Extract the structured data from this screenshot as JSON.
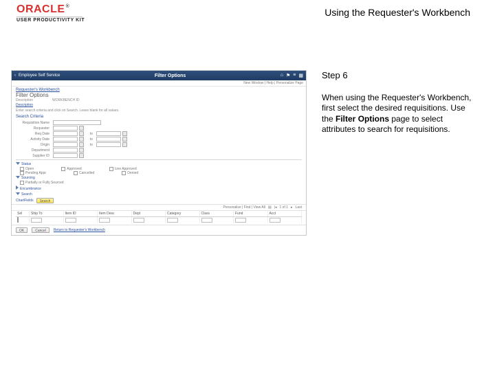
{
  "header": {
    "brand_top": "ORACLE",
    "brand_bottom": "USER PRODUCTIVITY KIT",
    "doc_title": "Using the Requester's Workbench"
  },
  "instruction": {
    "step_label": "Step 6",
    "text_before_bold": "When using the Requester's Workbench, first select the desired requisitions. Use the ",
    "bold": "Filter Options",
    "text_after_bold": " page to select attributes to search for requisitions."
  },
  "screenshot": {
    "topbar": {
      "back_label": "Employee Self Service",
      "title": "Filter Options"
    },
    "breadcrumb": "Requester's Workbench",
    "page_heading": "Filter Options",
    "sub_description": "Description",
    "sub_workbench": "WORKBENCH ID",
    "note": "Enter search criteria and click on Search. Leave blank for all values.",
    "section_criteria": "Search Criteria",
    "criteria_labels": [
      "Requisition Name",
      "Requester",
      "Req Date",
      "Activity Date",
      "Origin",
      "Department",
      "Supplier ID"
    ],
    "criteria_right_labels": [
      "to",
      "to",
      "to"
    ],
    "section_status": "Status",
    "status_options": [
      "Open",
      "Pending Appr",
      "Approved",
      "Cancelled",
      "Line Approved",
      "Denied"
    ],
    "section_sourcing": "Sourcing",
    "sourcing_option": "Partially or Fully Sourced",
    "section_encumbrance": "Encumbrance",
    "section_chartfields": "Search",
    "chartfields_label": "ChartFields",
    "search_btn": "Search",
    "grid": {
      "pager_text": "Personalize | Find | View All",
      "pager_range": "1 of 1",
      "pager_last": "Last",
      "columns": [
        "Sel",
        "Ship To",
        "Item ID",
        "Item Desc",
        "Dept",
        "Category",
        "Class",
        "Fund",
        "Acct"
      ]
    },
    "bottom": {
      "ok": "OK",
      "cancel": "Cancel",
      "return_link": "Return to Requester's Workbench"
    }
  }
}
